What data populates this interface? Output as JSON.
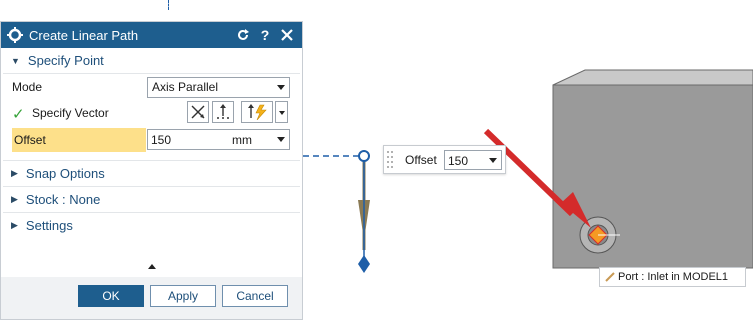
{
  "dialog": {
    "title": "Create Linear Path",
    "specify_point": {
      "label": "Specify Point"
    },
    "mode": {
      "label": "Mode",
      "value": "Axis Parallel"
    },
    "vector": {
      "label": "Specify Vector"
    },
    "offset": {
      "label": "Offset",
      "value": "150",
      "unit": "mm"
    },
    "sections": {
      "snap": "Snap Options",
      "stock": "Stock : None",
      "settings": "Settings"
    },
    "buttons": {
      "ok": "OK",
      "apply": "Apply",
      "cancel": "Cancel"
    }
  },
  "viewport": {
    "offset_widget": {
      "label": "Offset",
      "value": "150"
    },
    "tooltip": "Port : Inlet in MODEL1"
  },
  "colors": {
    "title_bar": "#1e5e8e",
    "offset_highlight": "#fde08a",
    "check": "#37a33a",
    "arrow": "#d42b2b",
    "vector": "#1e5ea8",
    "model_face": "#9a9a9a"
  }
}
